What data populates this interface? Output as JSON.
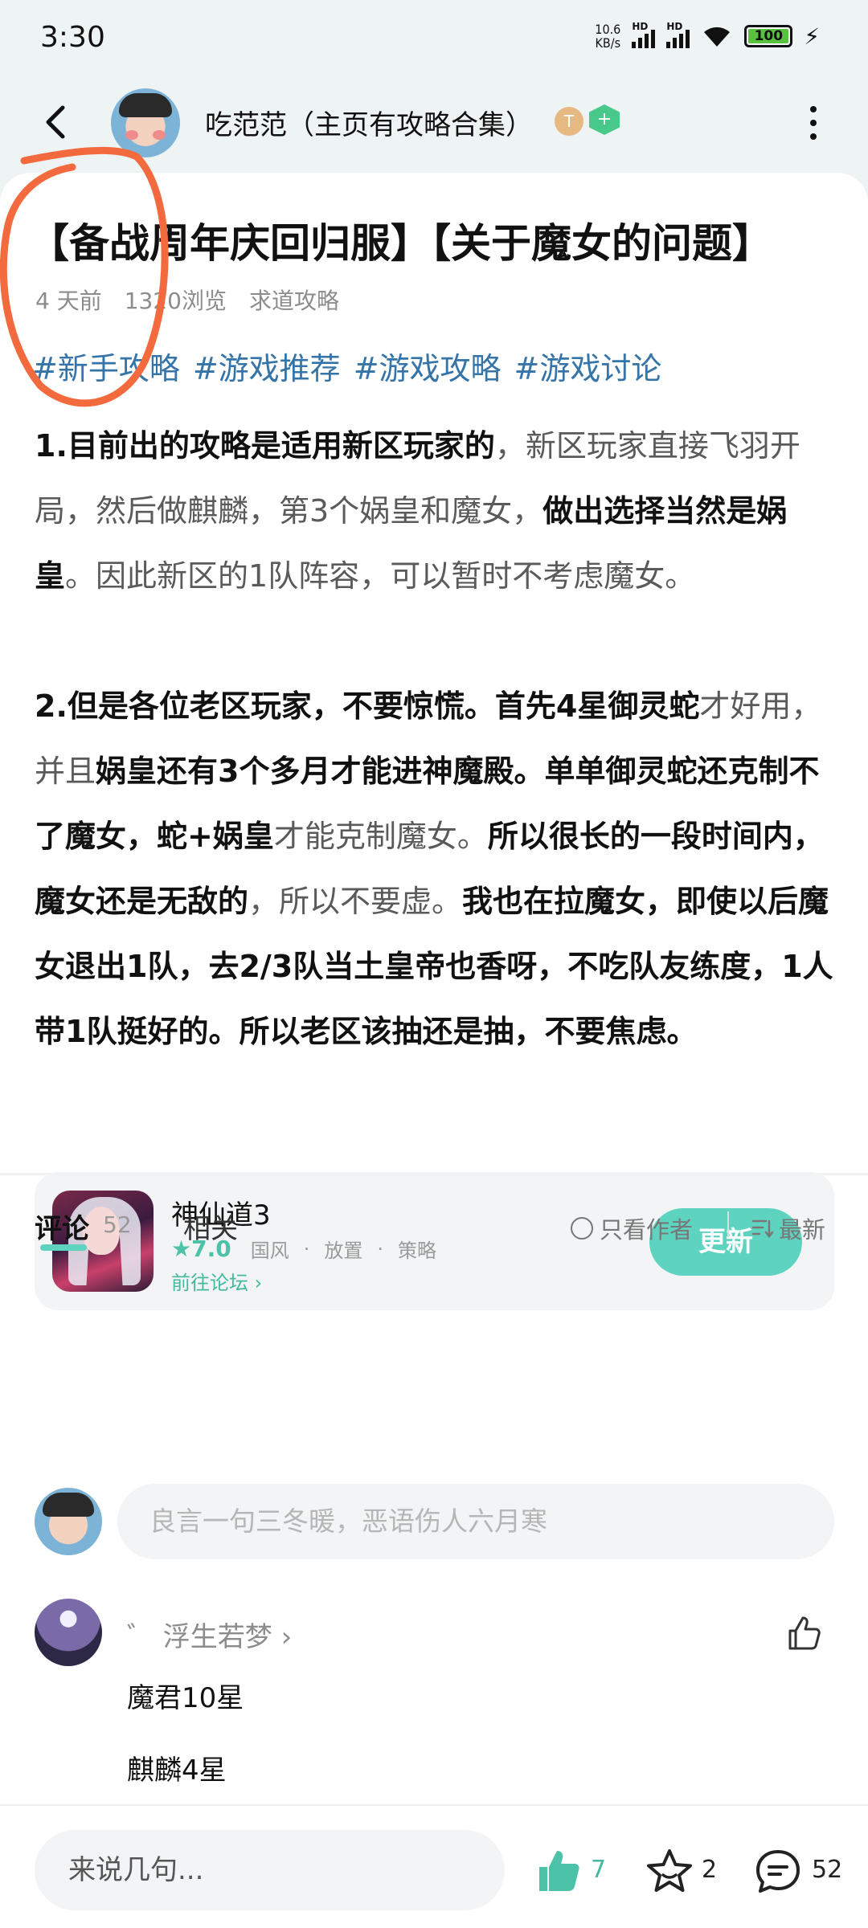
{
  "status_bar": {
    "time": "3:30",
    "net_speed_value": "10.6",
    "net_speed_unit": "KB/s",
    "signal_label": "HD",
    "battery": "100"
  },
  "header": {
    "author_name": "吃范范（主页有攻略合集）",
    "badge_t": "T",
    "badge_g": "+"
  },
  "post": {
    "title": "【备战周年庆回归服】【关于魔女的问题】",
    "time_ago": "4 天前",
    "views": "1320浏览",
    "category": "求道攻略",
    "tags": [
      "#新手攻略",
      "#游戏推荐",
      "#游戏攻略",
      "#游戏讨论"
    ],
    "para1_seg1": "1.目前出的攻略是适用新区玩家的",
    "para1_seg2": "，新区玩家直接飞羽开局，然后做麒麟，第3个娲皇和魔女，",
    "para1_seg3": "做出选择当然是娲皇",
    "para1_seg4": "。因此新区的1队阵容，可以暂时不考虑魔女。",
    "para2_seg1": "2.但是各位老区玩家，不要惊慌。首先4星御灵蛇",
    "para2_seg2": "才好用，并且",
    "para2_seg3": "娲皇还有3个多月才能进神魔殿。单单御灵蛇还克制不了魔女，蛇+娲皇",
    "para2_seg4": "才能克制魔女。",
    "para2_seg5": "所以很长的一段时间内，魔女还是无敌的",
    "para2_seg6": "，所以不要虚。",
    "para2_seg7": "我也在拉魔女，即使以后魔女退出1队，去2/3队当土皇帝也香呀，不吃队友练度，1人带1队挺好的。所以老区该抽还是抽，不要焦虑。"
  },
  "game_card": {
    "name": "神仙道3",
    "rating": "★7.0",
    "genres": [
      "国风",
      "放置",
      "策略"
    ],
    "forum_link": "前往论坛 ›",
    "update_button": "更新"
  },
  "comments_section": {
    "tab_comment": "评论",
    "comment_count": "52",
    "tab_related": "相关",
    "only_author": "只看作者",
    "sort_label": "最新",
    "input_placeholder": "良言一句三冬暖，恶语伤人六月寒"
  },
  "comment": {
    "user_name": "゛ 浮生若梦 ›",
    "line1": "魔君10星",
    "line2": "麒麟4星"
  },
  "bottom_bar": {
    "input_placeholder": "来说几句...",
    "like_count": "7",
    "star_count": "2",
    "comment_count": "52"
  },
  "colors": {
    "accent": "#5dd3c0",
    "tag_blue": "#3574a8",
    "annotation_orange": "#f26a3d"
  }
}
